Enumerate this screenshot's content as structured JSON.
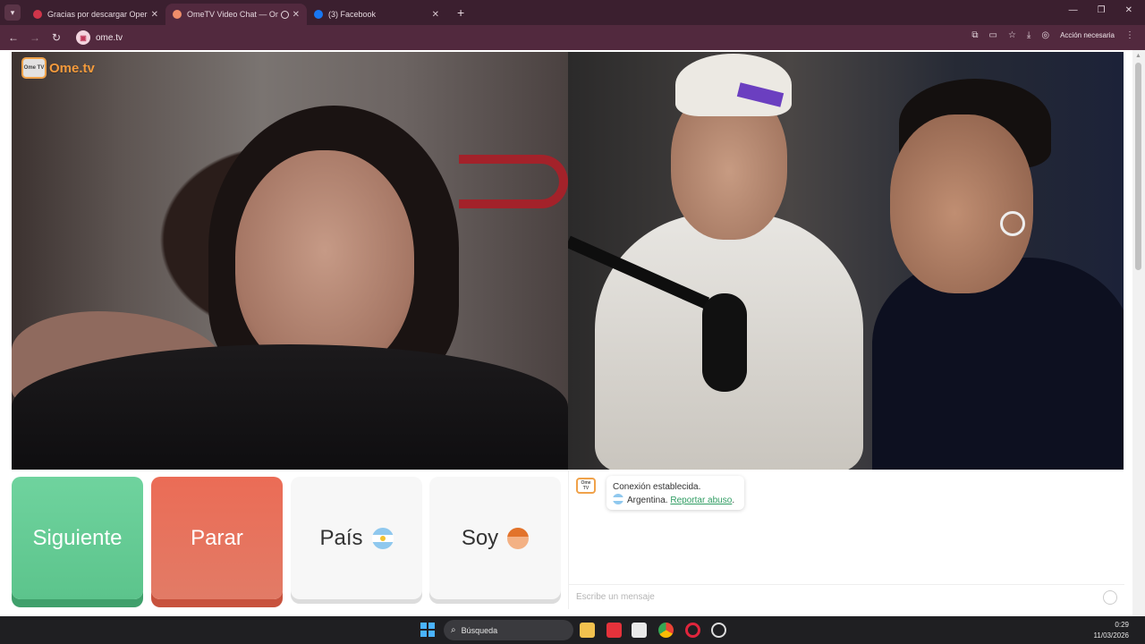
{
  "browser": {
    "tabs": [
      {
        "label": "Gracias por descargar Opera",
        "active": false,
        "favicon_color": "#d0354a"
      },
      {
        "label": "OmeTV Video Chat — Ome",
        "active": true,
        "favicon_color": "#ef8d6a"
      },
      {
        "label": "(3) Facebook",
        "active": false,
        "favicon_color": "#1877f2"
      }
    ],
    "url": "ome.tv",
    "action_label": "Acción necesaria"
  },
  "ometv": {
    "logo_tv": "Ome TV",
    "logo_text": "Ome.tv",
    "buttons": {
      "next": "Siguiente",
      "stop": "Parar",
      "country": "País",
      "gender": "Soy"
    },
    "chat": {
      "connection_message": "Conexión establecida.",
      "country": "Argentina.",
      "report_link": "Reportar abuso",
      "report_suffix": ".",
      "input_placeholder": "Escribe un mensaje"
    },
    "colors": {
      "next": "#5cc48c",
      "stop": "#e27b66",
      "brand": "#f39a3c"
    }
  },
  "taskbar": {
    "search_placeholder": "Búsqueda",
    "time": "0:29",
    "date": "11/03/2026"
  }
}
